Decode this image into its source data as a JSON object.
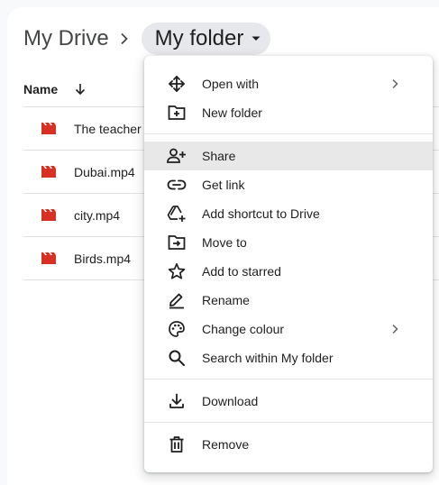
{
  "breadcrumb": {
    "root": "My Drive",
    "current": "My folder"
  },
  "list": {
    "name_header": "Name",
    "files": [
      {
        "name": "The teacher"
      },
      {
        "name": "Dubai.mp4"
      },
      {
        "name": "city.mp4"
      },
      {
        "name": "Birds.mp4"
      }
    ]
  },
  "menu": {
    "open_with": "Open with",
    "new_folder": "New folder",
    "share": "Share",
    "get_link": "Get link",
    "add_shortcut": "Add shortcut to Drive",
    "move_to": "Move to",
    "add_starred": "Add to starred",
    "rename": "Rename",
    "change_colour": "Change colour",
    "search_within": "Search within My folder",
    "download": "Download",
    "remove": "Remove"
  },
  "colors": {
    "video_icon": "#d93025",
    "hover": "#e8e8e8",
    "icon": "#1f1f1f"
  }
}
